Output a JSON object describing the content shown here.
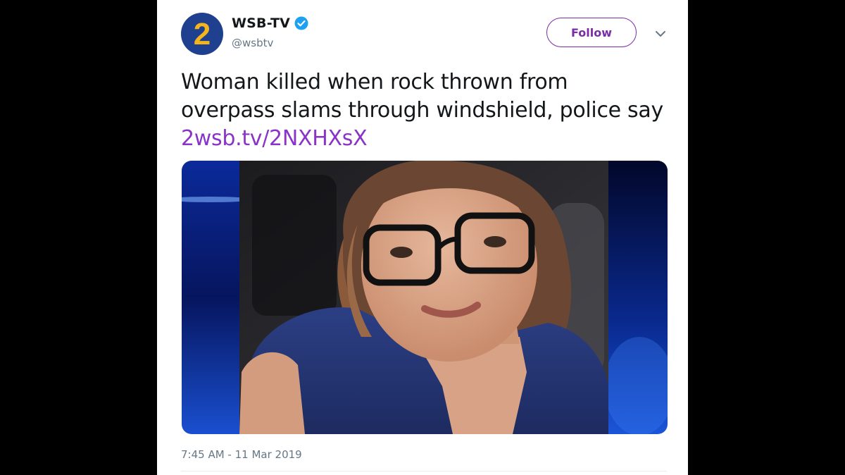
{
  "account": {
    "name": "WSB-TV",
    "handle": "@wsbtv",
    "avatar_icon": "channel-2-logo-icon",
    "verified_icon": "verified-badge-icon",
    "brand_colors": {
      "logo_blue": "#1f3f8f",
      "logo_gold": "#f3b51b",
      "verified": "#1da1f2"
    }
  },
  "actions": {
    "follow_label": "Follow",
    "follow_color": "#7b2ca8",
    "menu_icon": "chevron-down-icon"
  },
  "tweet": {
    "lines": [
      "Woman killed when rock thrown from",
      "overpass slams through windshield, police say"
    ],
    "link_text": "2wsb.tv/2NXHXsX",
    "link_color": "#8a34c7",
    "media_icon": "photo-image",
    "timestamp": "7:45 AM - 11 Mar 2019"
  }
}
